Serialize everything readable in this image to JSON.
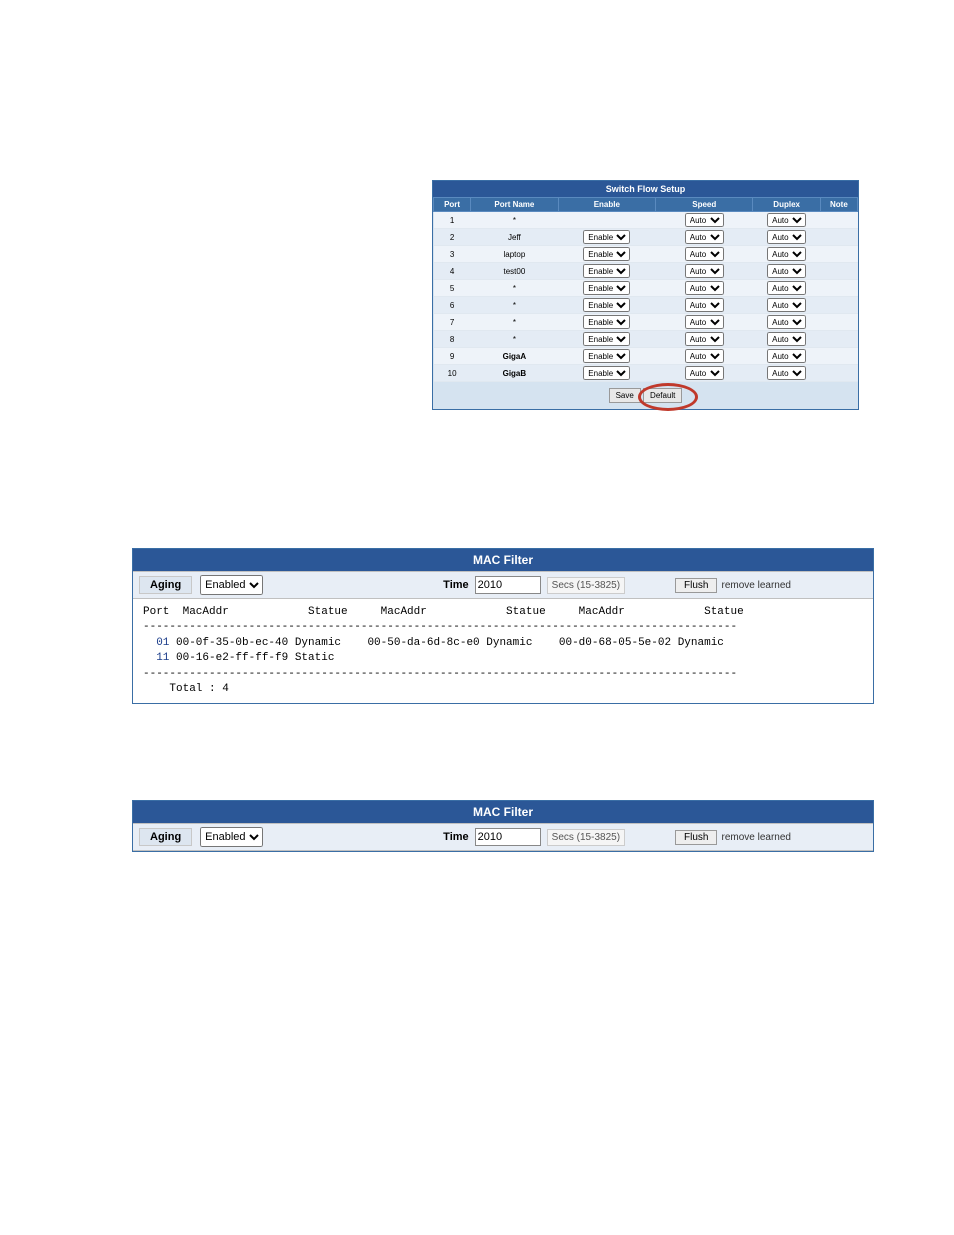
{
  "switchFlow": {
    "title": "Switch Flow Setup",
    "headers": [
      "Port",
      "Port Name",
      "Enable",
      "Speed",
      "Duplex",
      "Note"
    ],
    "enable": "Enable",
    "speed": "Auto",
    "duplex": "Auto",
    "rows": [
      {
        "port": "1",
        "name": "*",
        "enable": ""
      },
      {
        "port": "2",
        "name": "Jeff",
        "enable": "Enable"
      },
      {
        "port": "3",
        "name": "laptop",
        "enable": "Enable"
      },
      {
        "port": "4",
        "name": "test00",
        "enable": "Enable"
      },
      {
        "port": "5",
        "name": "*",
        "enable": "Enable"
      },
      {
        "port": "6",
        "name": "*",
        "enable": "Enable"
      },
      {
        "port": "7",
        "name": "*",
        "enable": "Enable"
      },
      {
        "port": "8",
        "name": "*",
        "enable": "Enable"
      },
      {
        "port": "9",
        "name": "GigaA",
        "enable": "Enable",
        "bold": true
      },
      {
        "port": "10",
        "name": "GigaB",
        "enable": "Enable",
        "bold": true
      }
    ],
    "saveBtn": "Save",
    "defaultBtn": "Default"
  },
  "macFilter": {
    "title": "MAC Filter",
    "agingLabel": "Aging",
    "agingValue": "Enabled",
    "timeLabel": "Time",
    "timeValue": "2010",
    "timeHint": "Secs (15-3825)",
    "flushBtn": "Flush",
    "flushNote": "remove learned",
    "headerLine": "Port  MacAddr            Statue     MacAddr            Statue     MacAddr            Statue",
    "entries": [
      {
        "port": "01",
        "mac1": "00-0f-35-0b-ec-40",
        "st1": "Dynamic",
        "mac2": "00-50-da-6d-8c-e0",
        "st2": "Dynamic",
        "mac3": "00-d0-68-05-5e-02",
        "st3": "Dynamic"
      },
      {
        "port": "11",
        "mac1": "00-16-e2-ff-ff-f9",
        "st1": "Static"
      }
    ],
    "totalLine": "    Total : 4"
  }
}
